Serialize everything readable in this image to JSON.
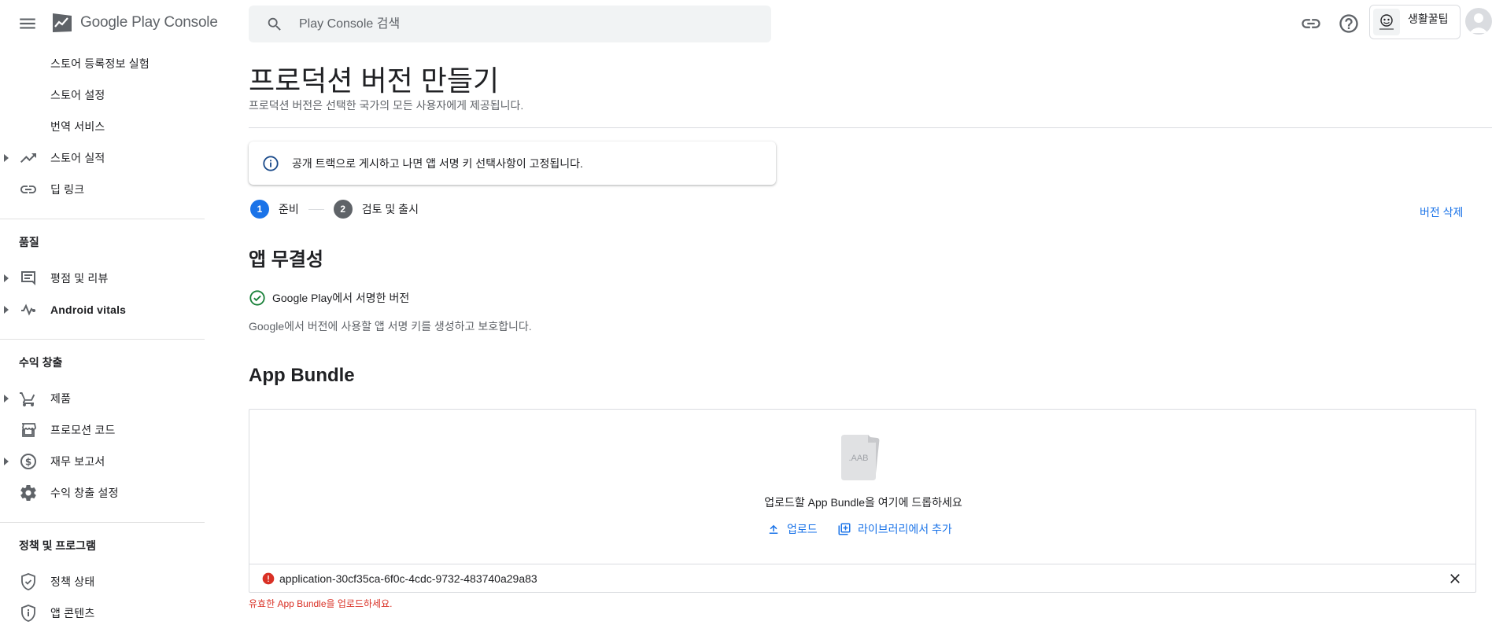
{
  "header": {
    "logo_text": "Google Play Console",
    "search_placeholder": "Play Console 검색",
    "account_name": "생활꿀팁"
  },
  "sidebar": {
    "items_top": [
      {
        "label": "스토어 등록정보 실험"
      },
      {
        "label": "스토어 설정"
      },
      {
        "label": "번역 서비스"
      },
      {
        "label": "스토어 실적",
        "icon": "trending-up-icon",
        "expandable": true
      },
      {
        "label": "딥 링크",
        "icon": "link-icon"
      }
    ],
    "quality_title": "품질",
    "quality_items": [
      {
        "label": "평점 및 리뷰",
        "icon": "reviews-icon",
        "expandable": true
      },
      {
        "label": "Android vitals",
        "icon": "vitals-icon",
        "expandable": true
      }
    ],
    "monetize_title": "수익 창출",
    "monetize_items": [
      {
        "label": "제품",
        "icon": "cart-icon",
        "expandable": true
      },
      {
        "label": "프로모션 코드",
        "icon": "store-icon"
      },
      {
        "label": "재무 보고서",
        "icon": "dollar-icon",
        "expandable": true
      },
      {
        "label": "수익 창출 설정",
        "icon": "gear-icon"
      }
    ],
    "policy_title": "정책 및 프로그램",
    "policy_items": [
      {
        "label": "정책 상태",
        "icon": "shield-check-icon"
      },
      {
        "label": "앱 콘텐츠",
        "icon": "shield-info-icon"
      }
    ]
  },
  "main": {
    "title": "프로덕션 버전 만들기",
    "subtitle": "프로덕션 버전은 선택한 국가의 모든 사용자에게 제공됩니다.",
    "info_message": "공개 트랙으로 게시하고 나면 앱 서명 키 선택사항이 고정됩니다.",
    "steps": [
      {
        "num": "1",
        "label": "준비"
      },
      {
        "num": "2",
        "label": "검토 및 출시"
      }
    ],
    "delete_label": "버전 삭제",
    "integrity_title": "앱 무결성",
    "signed_label": "Google Play에서 서명한 버전",
    "signed_desc": "Google에서 버전에 사용할 앱 서명 키를 생성하고 보호합니다.",
    "bundle_title": "App Bundle",
    "aab_label": ".AAB",
    "drop_text": "업로드할 App Bundle을 여기에 드롭하세요",
    "upload_label": "업로드",
    "library_label": "라이브러리에서 추가",
    "file_name": "application-30cf35ca-6f0c-4cdc-9732-483740a29a83",
    "error_text": "유효한 App Bundle을 업로드하세요."
  },
  "colors": {
    "accent": "#1a73e8",
    "success": "#188038",
    "error": "#d93025",
    "text": "#202124",
    "secondary": "#5f6368"
  }
}
